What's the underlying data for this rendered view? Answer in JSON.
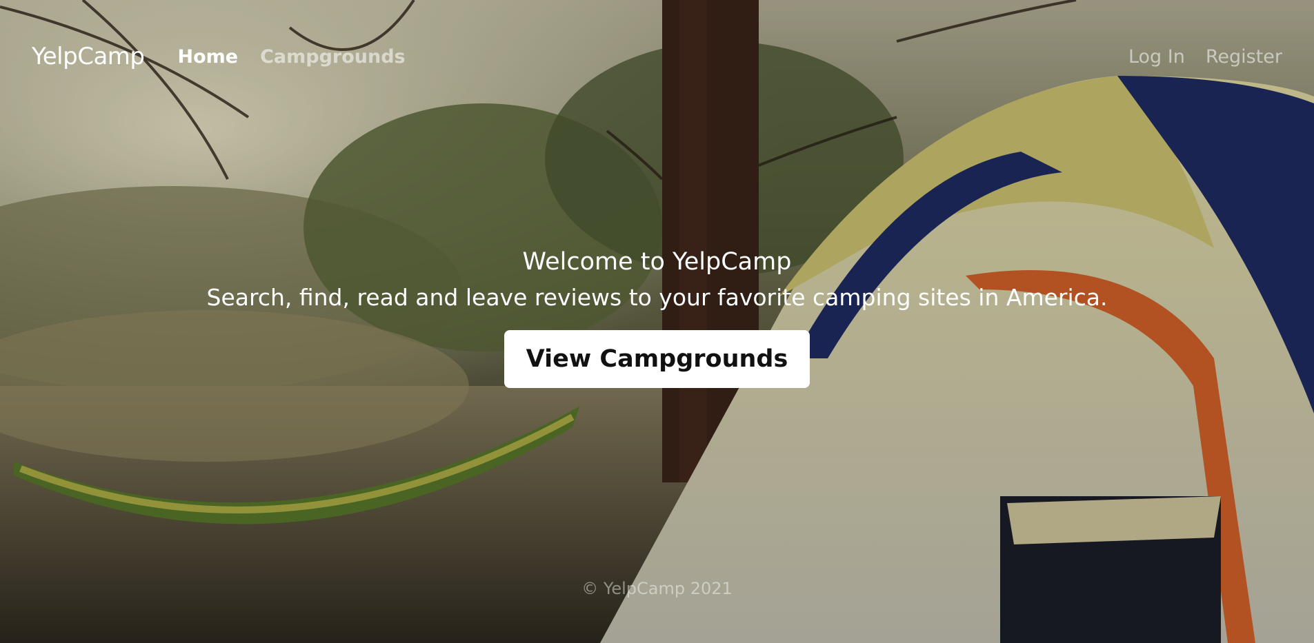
{
  "navbar": {
    "brand": "YelpCamp",
    "links": [
      {
        "label": "Home",
        "active": true
      },
      {
        "label": "Campgrounds",
        "active": false
      }
    ],
    "auth": [
      {
        "label": "Log In"
      },
      {
        "label": "Register"
      }
    ]
  },
  "hero": {
    "title": "Welcome to YelpCamp",
    "subtitle": "Search, find, read and leave reviews to your favorite camping sites in America.",
    "button": "View Campgrounds"
  },
  "footer": {
    "text": "© YelpCamp 2021"
  },
  "colors": {
    "text": "#ffffff",
    "button_bg": "#ffffff",
    "button_text": "#111111",
    "tent_blue": "#1f2d66",
    "tent_yellow": "#d8cf7a",
    "hammock_green": "#3f6a2a"
  }
}
